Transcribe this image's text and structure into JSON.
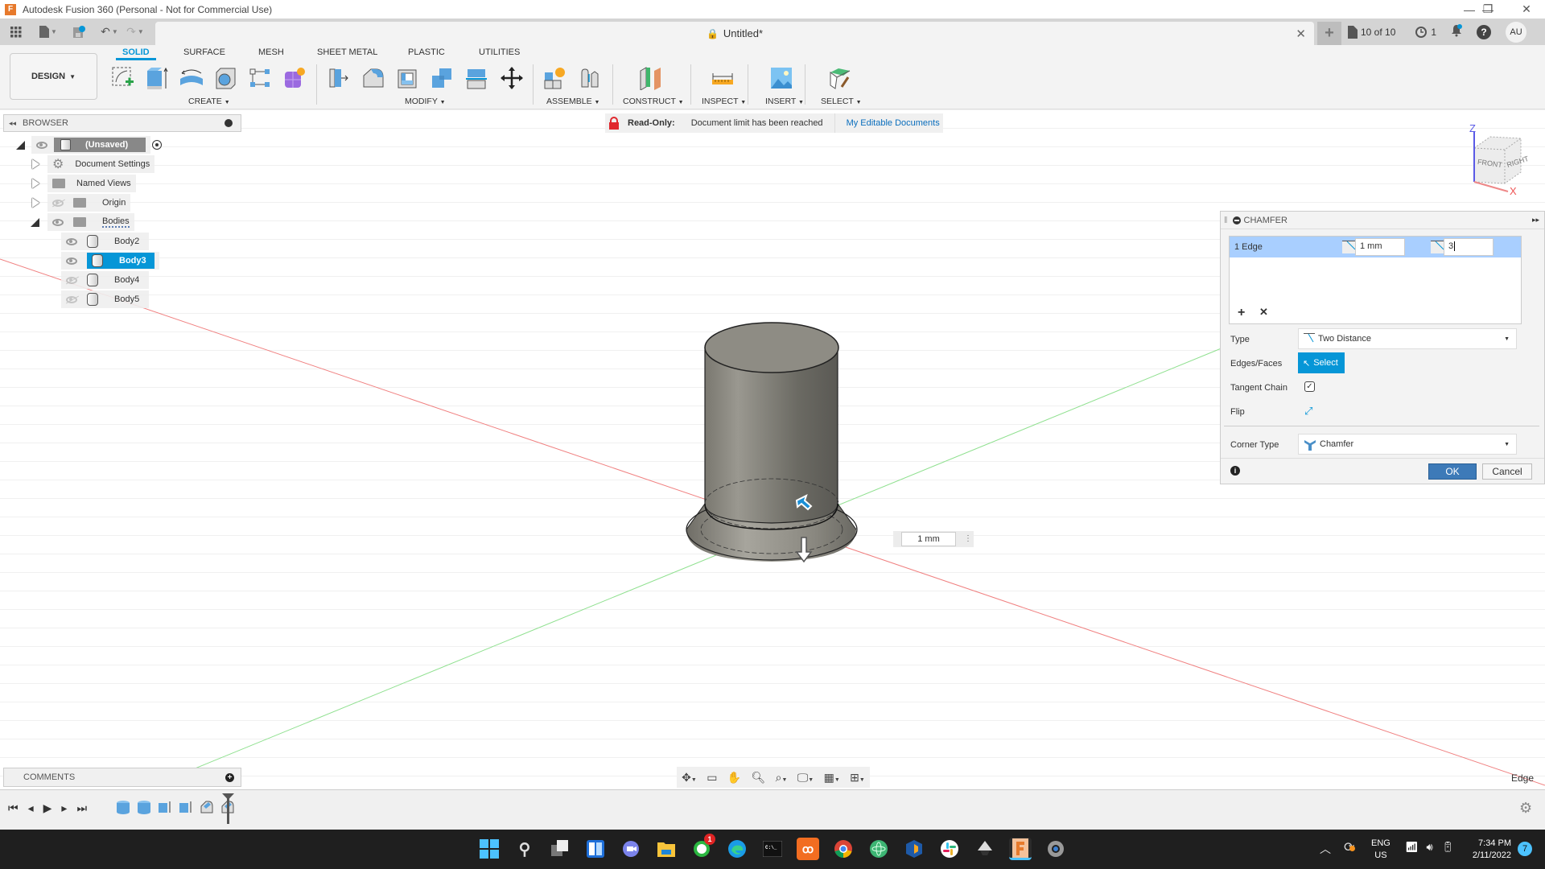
{
  "window": {
    "title": "Autodesk Fusion 360 (Personal - Not for Commercial Use)",
    "app_icon_letter": "F"
  },
  "tabbar": {
    "document_tab": "Untitled*",
    "jobs_label": "10 of 10",
    "history_count": "1",
    "user_initials": "AU"
  },
  "toolbar": {
    "workspace": "DESIGN",
    "tabs": [
      "SOLID",
      "SURFACE",
      "MESH",
      "SHEET METAL",
      "PLASTIC",
      "UTILITIES"
    ],
    "active_tab": "SOLID",
    "groups": [
      "CREATE",
      "MODIFY",
      "ASSEMBLE",
      "CONSTRUCT",
      "INSPECT",
      "INSERT",
      "SELECT"
    ]
  },
  "browser": {
    "header": "BROWSER",
    "root": "(Unsaved)",
    "items": [
      {
        "label": "Document Settings"
      },
      {
        "label": "Named Views"
      },
      {
        "label": "Origin"
      },
      {
        "label": "Bodies"
      }
    ],
    "bodies": [
      {
        "label": "Body2",
        "visible": true,
        "selected": false
      },
      {
        "label": "Body3",
        "visible": true,
        "selected": true
      },
      {
        "label": "Body4",
        "visible": false,
        "selected": false
      },
      {
        "label": "Body5",
        "visible": false,
        "selected": false
      }
    ]
  },
  "banner": {
    "label": "Read-Only:",
    "message": "Document limit has been reached",
    "link": "My Editable Documents"
  },
  "viewcube": {
    "front": "FRONT",
    "right": "RIGHT",
    "axis_z": "Z",
    "axis_x": "X"
  },
  "chamfer": {
    "title": "CHAMFER",
    "row_label": "1 Edge",
    "distance1": "1 mm",
    "distance2": "3",
    "type_label": "Type",
    "type_value": "Two Distance",
    "edges_label": "Edges/Faces",
    "select_label": "Select",
    "tangent_label": "Tangent Chain",
    "tangent_checked": true,
    "flip_label": "Flip",
    "corner_label": "Corner Type",
    "corner_value": "Chamfer",
    "ok": "OK",
    "cancel": "Cancel"
  },
  "viewport": {
    "dimension_input": "1 mm",
    "selection_status": "Edge"
  },
  "comments": {
    "header": "COMMENTS"
  },
  "taskbar": {
    "whatsapp_badge": "1",
    "lang_top": "ENG",
    "lang_bottom": "US",
    "time": "7:34 PM",
    "date": "2/11/2022",
    "notifications": "7"
  },
  "colors": {
    "accent": "#0696d7",
    "selected_row": "#a9cfff",
    "ok_button": "#3d7ab8",
    "readonly_lock": "#e0282e",
    "link": "#0a6ebd"
  }
}
